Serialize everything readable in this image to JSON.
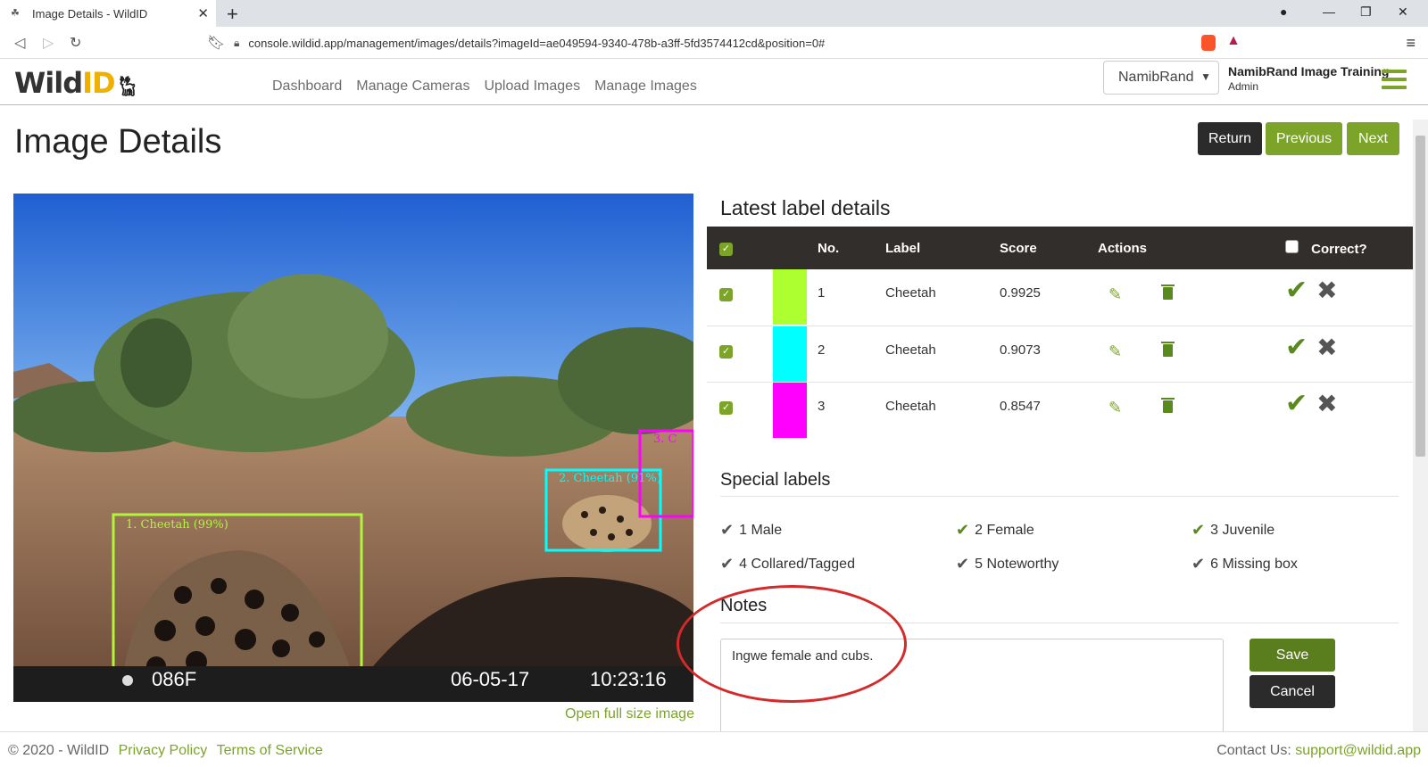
{
  "browser": {
    "tab_title": "Image Details - WildID",
    "url": "console.wildid.app/management/images/details?imageId=ae049594-9340-478b-a3ff-5fd3574412cd&position=0#"
  },
  "header": {
    "logo_text": "Wild",
    "logo_id": "ID",
    "nav": [
      "Dashboard",
      "Manage Cameras",
      "Upload Images",
      "Manage Images"
    ],
    "project_select": "NamibRand",
    "user_org": "NamibRand Image Training",
    "user_role": "Admin"
  },
  "page": {
    "title": "Image Details",
    "return_label": "Return",
    "previous_label": "Previous",
    "next_label": "Next"
  },
  "image": {
    "boxes": [
      {
        "label": "1. Cheetah (99%)",
        "color": "#b2f53a"
      },
      {
        "label": "2. Cheetah (91%)",
        "color": "#00ffff"
      },
      {
        "label": "3. C",
        "color": "#ff00ff"
      }
    ],
    "overlay_temp": "086F",
    "overlay_date": "06-05-17",
    "overlay_time": "10:23:16",
    "open_link": "Open full size image"
  },
  "labels": {
    "title": "Latest label details",
    "headers": {
      "no": "No.",
      "label": "Label",
      "score": "Score",
      "actions": "Actions",
      "correct": "Correct?"
    },
    "rows": [
      {
        "no": "1",
        "label": "Cheetah",
        "score": "0.9925",
        "color": "#adff2f"
      },
      {
        "no": "2",
        "label": "Cheetah",
        "score": "0.9073",
        "color": "#00ffff"
      },
      {
        "no": "3",
        "label": "Cheetah",
        "score": "0.8547",
        "color": "#ff00ff"
      }
    ]
  },
  "special": {
    "title": "Special labels",
    "items": [
      "1 Male",
      "2 Female",
      "3 Juvenile",
      "4 Collared/Tagged",
      "5 Noteworthy",
      "6 Missing box"
    ]
  },
  "notes": {
    "title": "Notes",
    "text": "Ingwe female and cubs.",
    "save_label": "Save",
    "cancel_label": "Cancel"
  },
  "footer": {
    "copyright": "© 2020 - WildID",
    "privacy": "Privacy Policy",
    "terms": "Terms of Service",
    "contact_prefix": "Contact Us:",
    "contact_email": "support@wildid.app"
  }
}
